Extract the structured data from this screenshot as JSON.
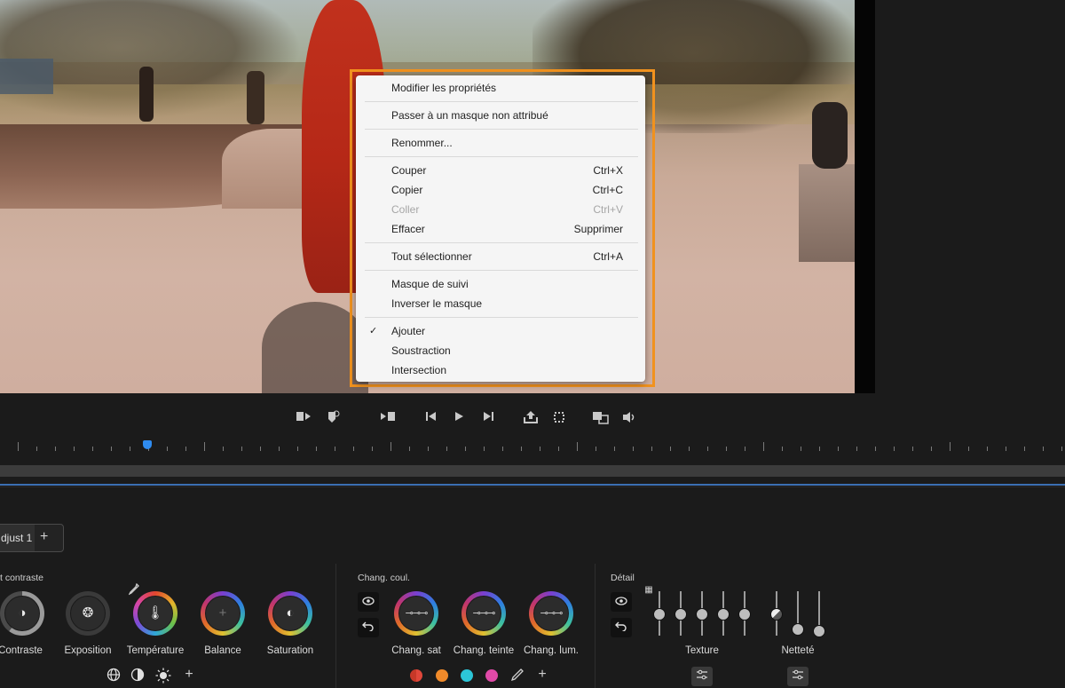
{
  "context_menu": {
    "items": [
      {
        "label": "Modifier les propriétés",
        "shortcut": ""
      },
      {
        "label": "Passer à un masque non attribué",
        "shortcut": ""
      },
      {
        "label": "Renommer...",
        "shortcut": ""
      },
      {
        "label": "Couper",
        "shortcut": "Ctrl+X"
      },
      {
        "label": "Copier",
        "shortcut": "Ctrl+C"
      },
      {
        "label": "Coller",
        "shortcut": "Ctrl+V",
        "disabled": true
      },
      {
        "label": "Effacer",
        "shortcut": "Supprimer"
      },
      {
        "label": "Tout sélectionner",
        "shortcut": "Ctrl+A"
      },
      {
        "label": "Masque de suivi",
        "shortcut": ""
      },
      {
        "label": "Inverser le masque",
        "shortcut": ""
      },
      {
        "label": "Ajouter",
        "shortcut": "",
        "checked": true
      },
      {
        "label": "Soustraction",
        "shortcut": ""
      },
      {
        "label": "Intersection",
        "shortcut": ""
      }
    ],
    "check_mark": "✓"
  },
  "tabs": {
    "adjust_label": "djust 1",
    "add_symbol": "+"
  },
  "sections": {
    "contrast": "t contraste",
    "color_change": "Chang. coul.",
    "detail": "Détail"
  },
  "knobs": {
    "contraste": "Contraste",
    "exposition": "Exposition",
    "temperature": "Température",
    "balance": "Balance",
    "saturation": "Saturation",
    "chang_sat": "Chang. sat",
    "chang_teinte": "Chang. teinte",
    "chang_lum": "Chang. lum."
  },
  "detail": {
    "texture": "Texture",
    "nettete": "Netteté"
  },
  "colors": {
    "mask_outline": "#f1921e",
    "playhead": "#2f8cf0",
    "swatches": [
      "#e0473a",
      "#f08a2a",
      "#2cc6d8",
      "#e04aa8"
    ]
  }
}
